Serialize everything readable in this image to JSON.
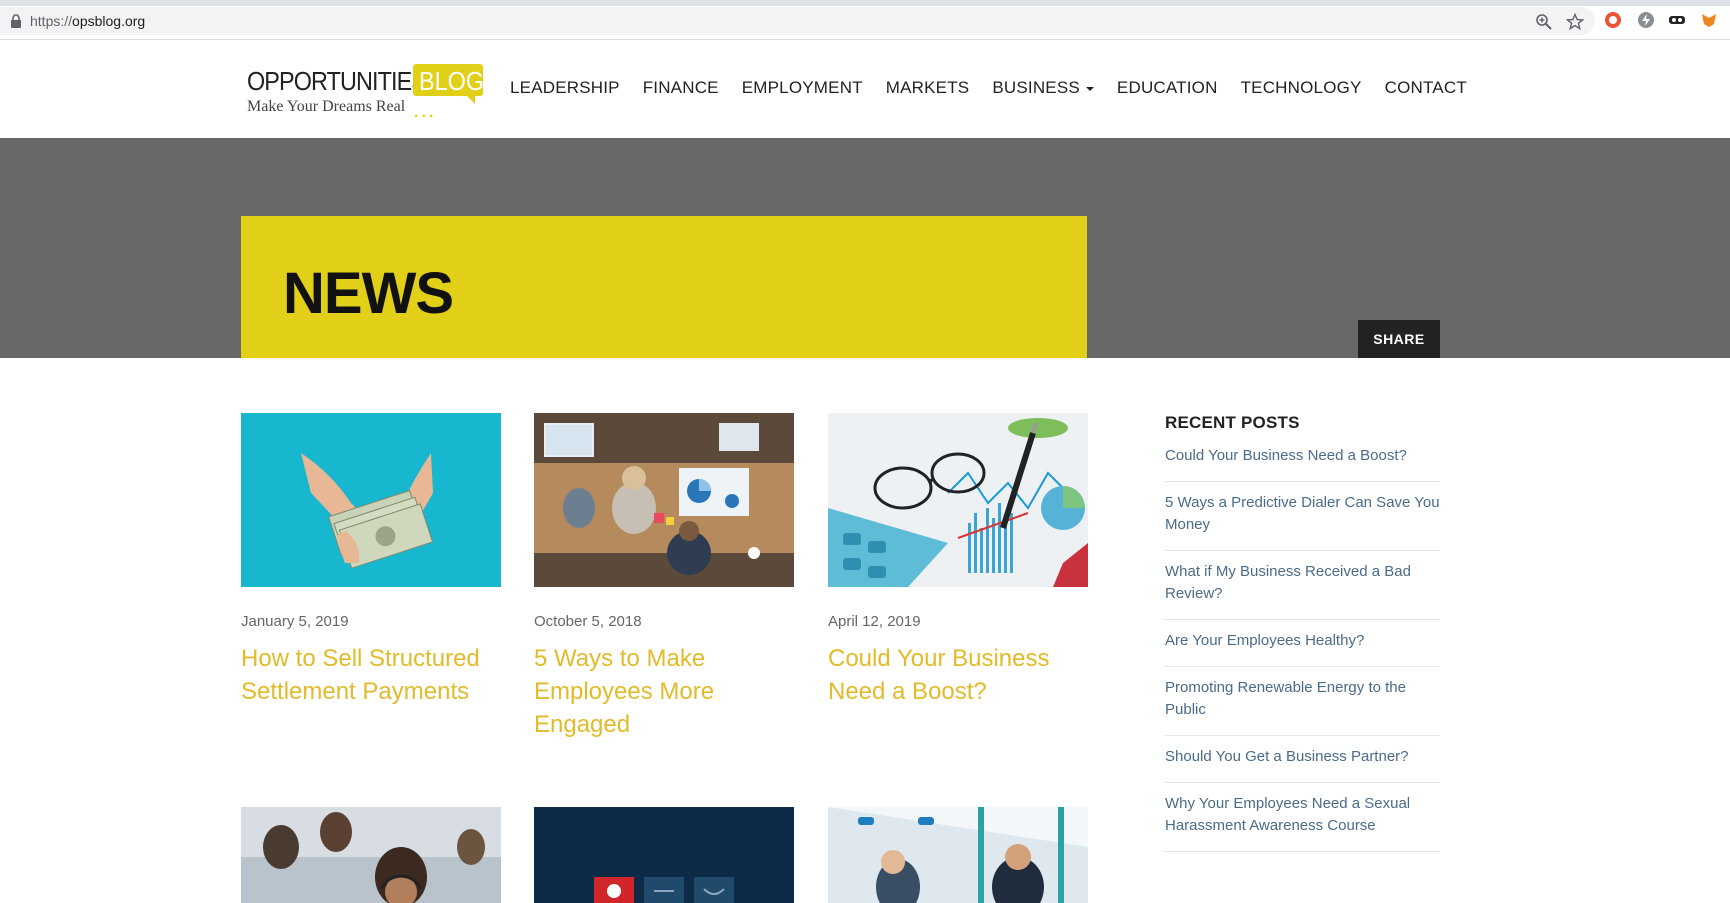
{
  "browser": {
    "url_scheme": "https://",
    "url_host": "opsblog.org"
  },
  "header": {
    "logo_word": "OPPORTUNITIES",
    "logo_blog": "BLOG",
    "logo_tagline": "Make Your Dreams Real",
    "logo_dots": "...",
    "nav": [
      {
        "label": "LEADERSHIP"
      },
      {
        "label": "FINANCE"
      },
      {
        "label": "EMPLOYMENT"
      },
      {
        "label": "MARKETS"
      },
      {
        "label": "BUSINESS"
      },
      {
        "label": "EDUCATION"
      },
      {
        "label": "TECHNOLOGY"
      },
      {
        "label": "CONTACT"
      }
    ]
  },
  "hero": {
    "title": "NEWS",
    "share_label": "SHARE"
  },
  "colors": {
    "accent_yellow": "#e2cf18",
    "hero_gray": "#686868",
    "title_gold": "#e2bb2a",
    "link_blue": "#4a6b8a"
  },
  "posts": [
    {
      "date": "January 5, 2019",
      "title": "How to Sell Structured Settlement Payments"
    },
    {
      "date": "October 5, 2018",
      "title": "5 Ways to Make Employees More Engaged"
    },
    {
      "date": "April 12, 2019",
      "title": "Could Your Business Need a Boost?"
    }
  ],
  "sidebar": {
    "title": "RECENT POSTS",
    "items": [
      {
        "label": "Could Your Business Need a Boost?"
      },
      {
        "label": "5 Ways a Predictive Dialer Can Save You Money"
      },
      {
        "label": "What if My Business Received a Bad Review?"
      },
      {
        "label": "Are Your Employees Healthy?"
      },
      {
        "label": "Promoting Renewable Energy to the Public"
      },
      {
        "label": "Should You Get a Business Partner?"
      },
      {
        "label": "Why Your Employees Need a Sexual Harassment Awareness Course"
      }
    ]
  }
}
